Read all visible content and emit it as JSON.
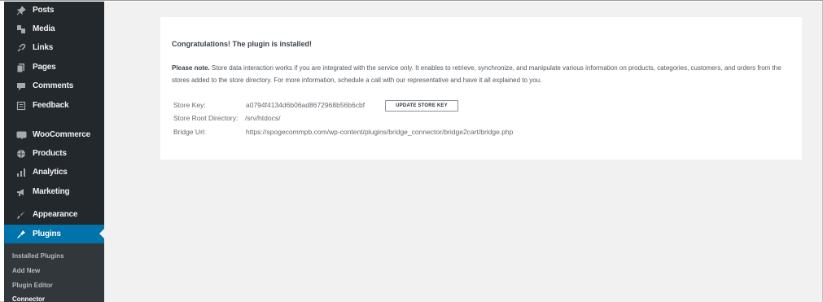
{
  "sidebar": {
    "items": [
      {
        "label": "Posts",
        "icon": "pin-icon"
      },
      {
        "label": "Media",
        "icon": "media-icon"
      },
      {
        "label": "Links",
        "icon": "links-icon"
      },
      {
        "label": "Pages",
        "icon": "pages-icon"
      },
      {
        "label": "Comments",
        "icon": "comments-icon"
      },
      {
        "label": "Feedback",
        "icon": "feedback-icon"
      },
      {
        "label": "WooCommerce",
        "icon": "woocommerce-icon"
      },
      {
        "label": "Products",
        "icon": "products-icon"
      },
      {
        "label": "Analytics",
        "icon": "analytics-icon"
      },
      {
        "label": "Marketing",
        "icon": "marketing-icon"
      },
      {
        "label": "Appearance",
        "icon": "appearance-icon"
      },
      {
        "label": "Plugins",
        "icon": "plugins-icon",
        "active": true
      }
    ],
    "submenu": [
      {
        "label": "Installed Plugins"
      },
      {
        "label": "Add New"
      },
      {
        "label": "Plugin Editor"
      },
      {
        "label": "Connector",
        "current": true
      }
    ]
  },
  "panel": {
    "title": "Congratulations! The plugin is installed!",
    "note_bold": "Please note.",
    "note_text": " Store data interaction works if you are integrated with the service only. It enables to retrieve, synchronize, and manipulate various information on products, categories, customers, and orders from the stores added to the store directory. For more information, schedule a call with our representative and have it all explained to you.",
    "store_key_label": "Store Key:",
    "store_key_value": "a0794f4134d6b06ad8672968b56b6cbf",
    "update_button": "UPDATE STORE KEY",
    "root_dir_label": "Store Root Directory:",
    "root_dir_value": "/srv/htdocs/",
    "bridge_url_label": "Bridge Url:",
    "bridge_url_value": "https://spogecommpb.com/wp-content/plugins/bridge_connector/bridge2cart/bridge.php"
  },
  "colors": {
    "sidebar_bg": "#23282d",
    "active_bg": "#0073aa",
    "content_bg": "#f1f1f1"
  }
}
